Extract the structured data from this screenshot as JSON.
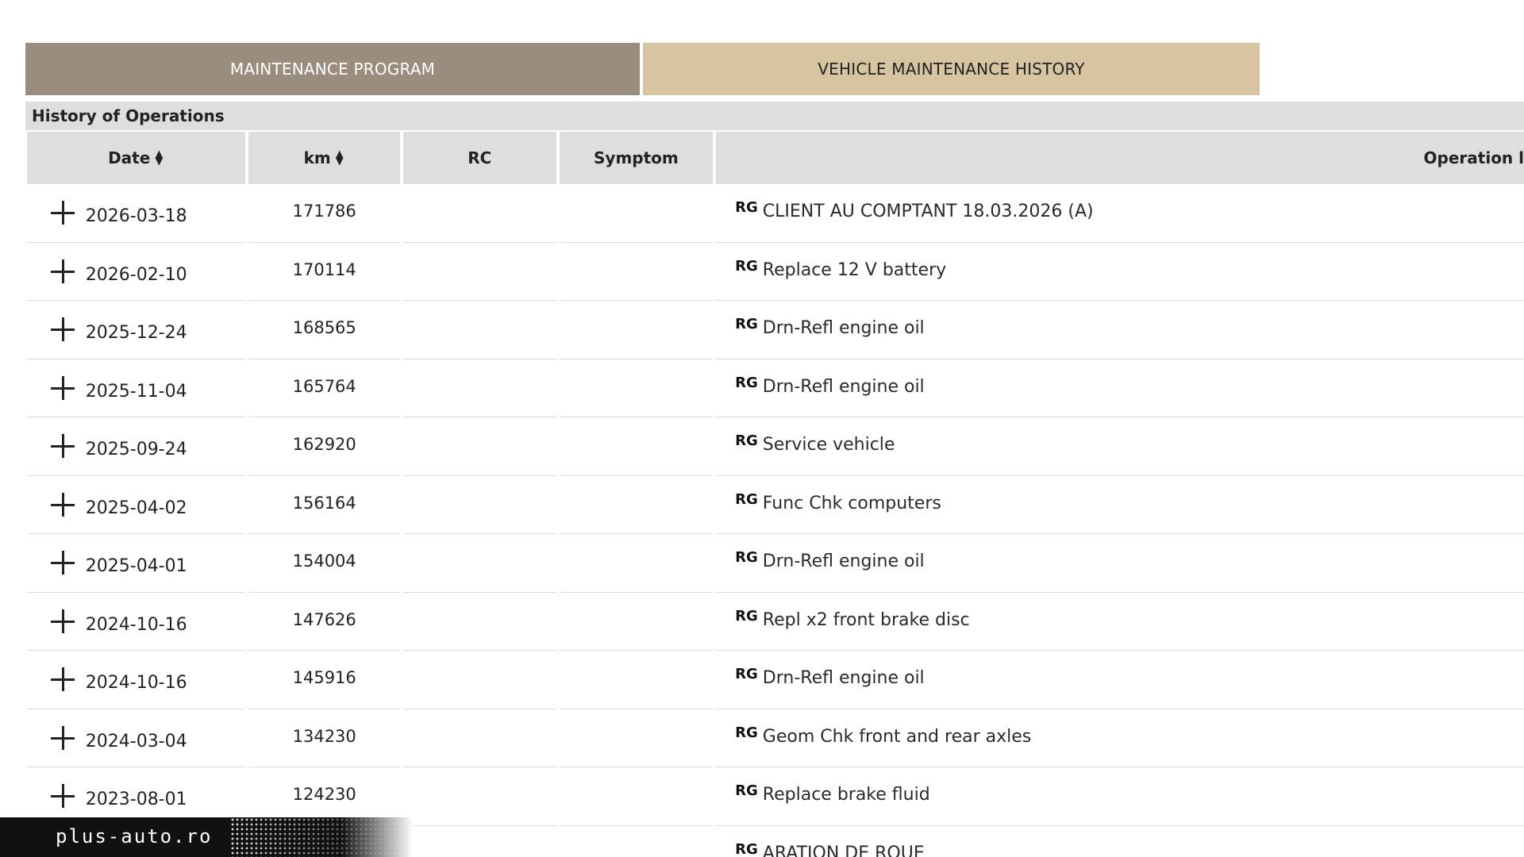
{
  "tabs": {
    "program_label": "MAINTENANCE PROGRAM",
    "history_label": "VEHICLE MAINTENANCE HISTORY"
  },
  "section": {
    "title": "History of Operations"
  },
  "table": {
    "headers": {
      "date": "Date",
      "km": "km",
      "rc": "RC",
      "symptom": "Symptom",
      "operation": "Operation l"
    },
    "rows": [
      {
        "date": "2026-03-18",
        "km": "171786",
        "tag": "RG",
        "operation": "CLIENT AU COMPTANT 18.03.2026 (A)"
      },
      {
        "date": "2026-02-10",
        "km": "170114",
        "tag": "RG",
        "operation": "Replace 12 V battery"
      },
      {
        "date": "2025-12-24",
        "km": "168565",
        "tag": "RG",
        "operation": "Drn-Refl engine oil"
      },
      {
        "date": "2025-11-04",
        "km": "165764",
        "tag": "RG",
        "operation": "Drn-Refl engine oil"
      },
      {
        "date": "2025-09-24",
        "km": "162920",
        "tag": "RG",
        "operation": "Service vehicle"
      },
      {
        "date": "2025-04-02",
        "km": "156164",
        "tag": "RG",
        "operation": "Func Chk computers"
      },
      {
        "date": "2025-04-01",
        "km": "154004",
        "tag": "RG",
        "operation": "Drn-Refl engine oil"
      },
      {
        "date": "2024-10-16",
        "km": "147626",
        "tag": "RG",
        "operation": "Repl x2 front brake disc"
      },
      {
        "date": "2024-10-16",
        "km": "145916",
        "tag": "RG",
        "operation": "Drn-Refl engine oil"
      },
      {
        "date": "2024-03-04",
        "km": "134230",
        "tag": "RG",
        "operation": "Geom Chk front and rear axles"
      },
      {
        "date": "2023-08-01",
        "km": "124230",
        "tag": "RG",
        "operation": "Replace brake fluid"
      },
      {
        "date": "",
        "km": "",
        "tag": "RG",
        "operation": "ARATION DE ROUE"
      }
    ]
  },
  "watermark": {
    "text": "plus-auto.ro"
  }
}
